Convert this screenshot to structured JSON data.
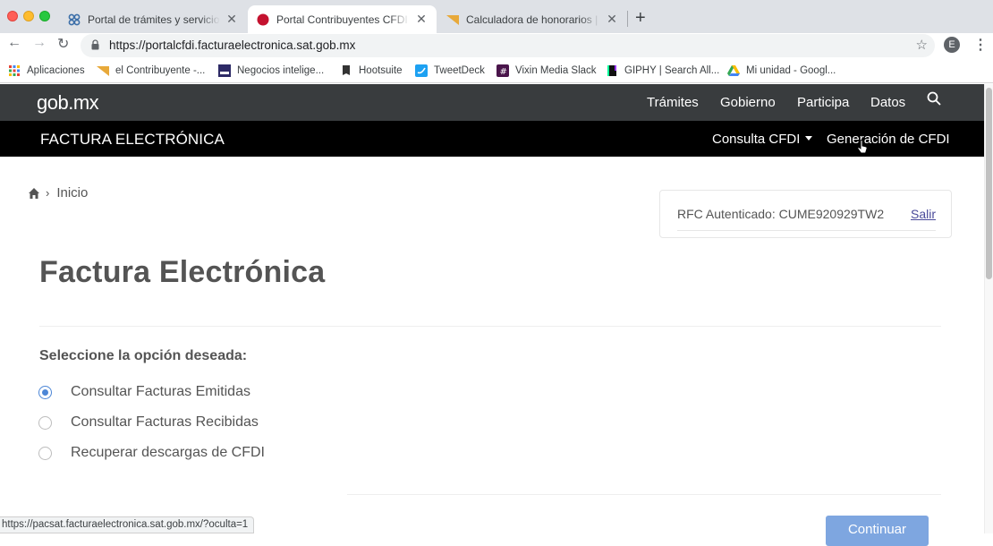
{
  "browser": {
    "tabs": [
      {
        "title": "Portal de trámites y servicios - SAT",
        "active": false
      },
      {
        "title": "Portal Contribuyentes CFDI | SAT",
        "active": true
      },
      {
        "title": "Calculadora de honorarios | el Contribuyente",
        "active": false
      }
    ],
    "url": "https://portalcfdi.facturaelectronica.sat.gob.mx",
    "profile_initial": "E",
    "bookmarks": [
      {
        "label": "Aplicaciones",
        "icon": "apps-grid-icon"
      },
      {
        "label": "el Contribuyente -...",
        "icon": "el-contribuyente-icon"
      },
      {
        "label": "Negocios intelige...",
        "icon": "negocios-icon"
      },
      {
        "label": "Hootsuite",
        "icon": "hootsuite-icon"
      },
      {
        "label": "TweetDeck",
        "icon": "tweetdeck-icon"
      },
      {
        "label": "Vixin Media Slack",
        "icon": "slack-icon"
      },
      {
        "label": "GIPHY | Search All...",
        "icon": "giphy-icon"
      },
      {
        "label": "Mi unidad - Googl...",
        "icon": "google-drive-icon"
      }
    ],
    "status_url": "https://pacsat.facturaelectronica.sat.gob.mx/?oculta=1"
  },
  "gob_header": {
    "logo": "gob.mx",
    "nav": [
      "Trámites",
      "Gobierno",
      "Participa",
      "Datos"
    ]
  },
  "site_header": {
    "title": "FACTURA ELECTRÓNICA",
    "nav": [
      "Consulta CFDI",
      "Generación de CFDI"
    ]
  },
  "breadcrumb": {
    "home": "Inicio"
  },
  "rfc": {
    "text": "RFC Autenticado: CUME920929TW2",
    "logout": "Salir"
  },
  "page": {
    "title": "Factura Electrónica",
    "prompt": "Seleccione la opción deseada:",
    "options": [
      {
        "label": "Consultar Facturas Emitidas",
        "checked": true
      },
      {
        "label": "Consultar Facturas Recibidas",
        "checked": false
      },
      {
        "label": "Recuperar descargas de CFDI",
        "checked": false
      }
    ],
    "continue_button": "Continuar"
  },
  "colors": {
    "gob_bar": "#393c3e",
    "site_bar": "#000000",
    "accent_blue": "#4c86d6",
    "button_blue": "#7ea6e0",
    "text_gray": "#545454"
  }
}
